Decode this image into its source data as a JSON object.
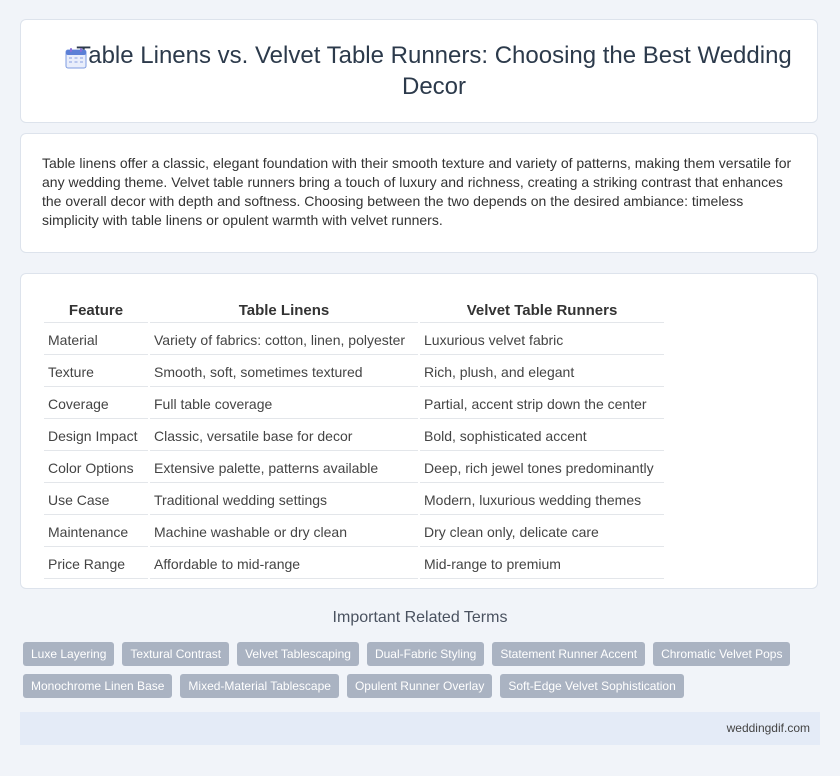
{
  "header": {
    "title": "Table Linens vs. Velvet Table Runners: Choosing the Best Wedding Decor",
    "icon": "calendar-icon"
  },
  "intro": {
    "text": "Table linens offer a classic, elegant foundation with their smooth texture and variety of patterns, making them versatile for any wedding theme. Velvet table runners bring a touch of luxury and richness, creating a striking contrast that enhances the overall decor with depth and softness. Choosing between the two depends on the desired ambiance: timeless simplicity with table linens or opulent warmth with velvet runners."
  },
  "table": {
    "headers": [
      "Feature",
      "Table Linens",
      "Velvet Table Runners"
    ],
    "rows": [
      [
        "Material",
        "Variety of fabrics: cotton, linen, polyester",
        "Luxurious velvet fabric"
      ],
      [
        "Texture",
        "Smooth, soft, sometimes textured",
        "Rich, plush, and elegant"
      ],
      [
        "Coverage",
        "Full table coverage",
        "Partial, accent strip down the center"
      ],
      [
        "Design Impact",
        "Classic, versatile base for decor",
        "Bold, sophisticated accent"
      ],
      [
        "Color Options",
        "Extensive palette, patterns available",
        "Deep, rich jewel tones predominantly"
      ],
      [
        "Use Case",
        "Traditional wedding settings",
        "Modern, luxurious wedding themes"
      ],
      [
        "Maintenance",
        "Machine washable or dry clean",
        "Dry clean only, delicate care"
      ],
      [
        "Price Range",
        "Affordable to mid-range",
        "Mid-range to premium"
      ]
    ]
  },
  "related": {
    "heading": "Important Related Terms",
    "tags": [
      "Luxe Layering",
      "Textural Contrast",
      "Velvet Tablescaping",
      "Dual-Fabric Styling",
      "Statement Runner Accent",
      "Chromatic Velvet Pops",
      "Monochrome Linen Base",
      "Mixed-Material Tablescape",
      "Opulent Runner Overlay",
      "Soft-Edge Velvet Sophistication"
    ]
  },
  "footer": {
    "site": "weddingdif.com"
  },
  "colors": {
    "page_bg": "#f1f4f9",
    "tag_bg": "#aab3c2",
    "footer_bg": "#e4ebf7",
    "icon_accent": "#5b7fd6"
  }
}
